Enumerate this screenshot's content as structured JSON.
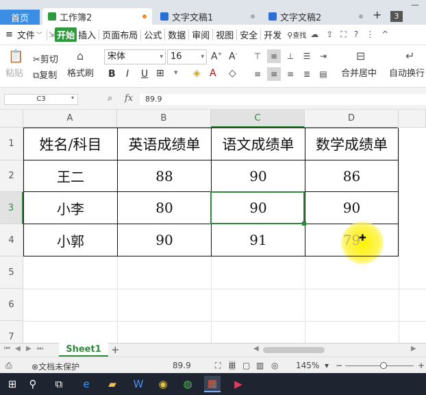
{
  "tabs": {
    "home": "首页",
    "workbook": "工作簿2",
    "doc1": "文字文稿1",
    "doc2": "文字文稿2",
    "plus": "+",
    "count": "3"
  },
  "menu": {
    "file": "文件",
    "items": [
      "开始",
      "插入",
      "页面布局",
      "公式",
      "数据",
      "审阅",
      "视图",
      "安全",
      "开发"
    ],
    "search": "查找"
  },
  "ribbon": {
    "paste": "粘贴",
    "cut": "剪切",
    "copy": "复制",
    "format_painter": "格式刷",
    "font_name": "宋体",
    "font_size": "16",
    "bold": "B",
    "italic": "I",
    "underline": "U",
    "merge_center": "合并居中",
    "wrap_text": "自动换行"
  },
  "formula_bar": {
    "cell_ref": "C3",
    "fx": "fx",
    "value": "89.9"
  },
  "columns": [
    "A",
    "B",
    "C",
    "D"
  ],
  "rows": [
    "1",
    "2",
    "3",
    "4",
    "5",
    "6",
    "7"
  ],
  "table": {
    "headers": [
      "姓名/科目",
      "英语成绩单",
      "语文成绩单",
      "数学成绩单"
    ],
    "data": [
      [
        "王二",
        "88",
        "90",
        "86"
      ],
      [
        "小李",
        "80",
        "90",
        "90"
      ],
      [
        "小郭",
        "90",
        "91",
        "79"
      ]
    ]
  },
  "selection": {
    "column": "C",
    "row": "3"
  },
  "sheets": [
    "Sheet1"
  ],
  "status": {
    "protect": "文档未保护",
    "value": "89.9",
    "zoom": "145%"
  },
  "colors": {
    "accent_green": "#2c8a3a",
    "home_tab_blue": "#3c8ee5",
    "taskbar": "#1e2430"
  }
}
